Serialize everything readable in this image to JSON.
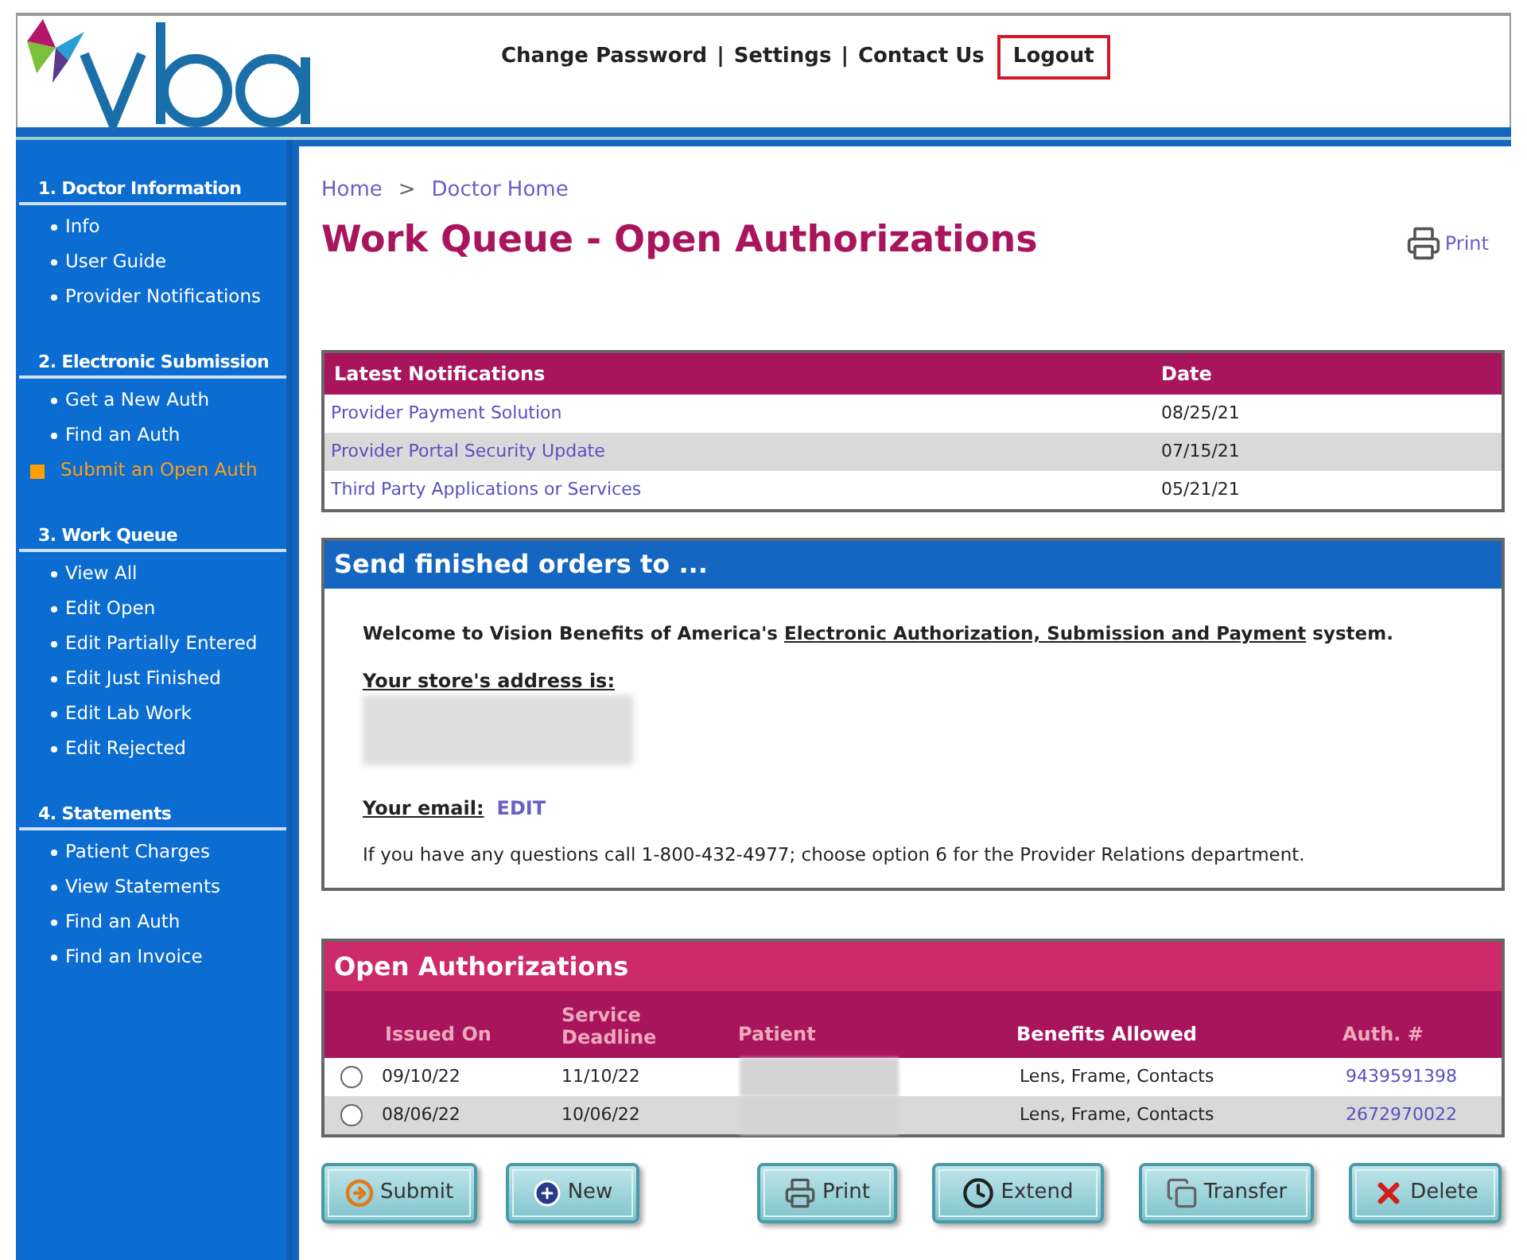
{
  "header": {
    "links": [
      {
        "label": "Change Password",
        "highlighted": false
      },
      {
        "label": "Settings",
        "highlighted": false
      },
      {
        "label": "Contact Us",
        "highlighted": false
      },
      {
        "label": "Logout",
        "highlighted": true
      }
    ],
    "separator": "|"
  },
  "sidebar": {
    "sections": [
      {
        "title": "1. Doctor Information",
        "items": [
          {
            "label": "Info",
            "selected": false
          },
          {
            "label": "User Guide",
            "selected": false
          },
          {
            "label": "Provider Notifications",
            "selected": false
          }
        ]
      },
      {
        "title": "2. Electronic Submission",
        "items": [
          {
            "label": "Get a New Auth",
            "selected": false
          },
          {
            "label": "Find an Auth",
            "selected": false
          },
          {
            "label": "Submit an Open Auth",
            "selected": true
          }
        ]
      },
      {
        "title": "3. Work Queue",
        "items": [
          {
            "label": "View All",
            "selected": false
          },
          {
            "label": "Edit Open",
            "selected": false
          },
          {
            "label": "Edit Partially Entered",
            "selected": false
          },
          {
            "label": "Edit Just Finished",
            "selected": false
          },
          {
            "label": "Edit Lab Work",
            "selected": false
          },
          {
            "label": "Edit Rejected",
            "selected": false
          }
        ]
      },
      {
        "title": "4. Statements",
        "items": [
          {
            "label": "Patient Charges",
            "selected": false
          },
          {
            "label": "View Statements",
            "selected": false
          },
          {
            "label": "Find an Auth",
            "selected": false
          },
          {
            "label": "Find an Invoice",
            "selected": false
          }
        ]
      }
    ]
  },
  "breadcrumb": {
    "items": [
      "Home",
      "Doctor Home"
    ],
    "separator": ">"
  },
  "page_title": "Work Queue - Open Authorizations",
  "print_link": "Print",
  "notifications": {
    "columns": [
      "Latest Notifications",
      "Date"
    ],
    "rows": [
      {
        "title": "Provider Payment Solution",
        "date": "08/25/21"
      },
      {
        "title": "Provider Portal Security Update",
        "date": "07/15/21"
      },
      {
        "title": "Third Party Applications or Services",
        "date": "05/21/21"
      }
    ]
  },
  "send_box": {
    "title": "Send finished orders to ...",
    "welcome": [
      "Welcome to Vision Benefits of America's",
      "Electronic Authorization, Submission and Payment",
      "system."
    ],
    "address_label": "Your store's address is:",
    "email_label": "Your email:",
    "email_edit": "EDIT",
    "help": "If you have any questions call 1-800-432-4977; choose option 6 for the Provider Relations department."
  },
  "open_auths": {
    "title": "Open Authorizations",
    "columns": [
      "Issued On",
      "Service Deadline",
      "Patient",
      "Benefits Allowed",
      "Auth. #"
    ],
    "rows": [
      {
        "selected": false,
        "issued": "09/10/22",
        "deadline": "11/10/22",
        "benefits": "Lens, Frame, Contacts",
        "auth": "9439591398"
      },
      {
        "selected": false,
        "issued": "08/06/22",
        "deadline": "10/06/22",
        "benefits": "Lens, Frame, Contacts",
        "auth": "2672970022"
      }
    ]
  },
  "buttons": [
    {
      "kind": "submit",
      "label": "Submit"
    },
    {
      "kind": "new",
      "label": "New"
    },
    {
      "kind": "print",
      "label": "Print"
    },
    {
      "kind": "extend",
      "label": "Extend"
    },
    {
      "kind": "transfer",
      "label": "Transfer"
    },
    {
      "kind": "delete",
      "label": "Delete"
    }
  ]
}
